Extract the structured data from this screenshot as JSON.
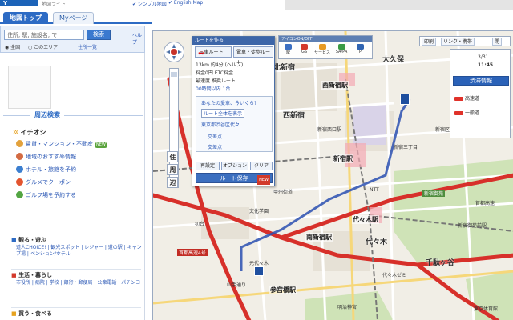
{
  "header": {
    "logo": "Y",
    "logo_sub": "地図ライト",
    "link1": "✔ シンプル地図",
    "link2": "✔ English Map"
  },
  "tabs": [
    {
      "label": "地図トップ"
    },
    {
      "label": "Myページ"
    }
  ],
  "search": {
    "placeholder": "住所, 駅, 施設名, で",
    "button": "検索",
    "help": "ヘルプ",
    "opt1": "◉ 全国",
    "opt2": "○ このエリア",
    "opt3": "住所一覧"
  },
  "sidebar": {
    "around_title": "周辺検索",
    "pickup_title": "イチオシ",
    "pickup_items": [
      {
        "label": "賃貸・マンション・不動産",
        "badge": "NEW"
      },
      {
        "label": "地域のおすすめ情報",
        "badge": ""
      },
      {
        "label": "ホテル・旅館を予約",
        "badge": ""
      },
      {
        "label": "グルメでクーポン",
        "badge": ""
      },
      {
        "label": "ゴルフ場を予約する",
        "badge": ""
      }
    ],
    "sections": [
      {
        "title": "観る・遊ぶ",
        "links": "道人CHOICE! | 観光スポット | レジャー | 道の駅 | キャンプ場 | ペンション/ホテル"
      },
      {
        "title": "生活・暮らし",
        "links": "市役所 | 病院 | 学校 | 銀行・郵便局 | 公衆電話 | パチンコ"
      },
      {
        "title": "買う・食べる",
        "links": ""
      }
    ]
  },
  "map": {
    "labels": {
      "nishishinjuku": "西新宿駅",
      "shinjuku": "新宿駅",
      "yoyogi": "代々木駅",
      "minamishinjuku": "南新宿駅",
      "sangubashi": "参宮橋駅",
      "kitashinjuku": "北新宿",
      "okubo": "大久保",
      "nishishinjuku_area": "西新宿",
      "yoyogi_area": "代々木",
      "sendagaya": "千駄ヶ谷",
      "park_label": "新宿御苑",
      "meiji": "明治神宮",
      "yoyogi_school": "代々木ゼミ",
      "bunka": "文化学園",
      "hatsudai": "初台",
      "motoyoyogi": "元代々木",
      "shinjuku_gyoen": "新宿御苑前駅",
      "ntt": "NTT",
      "kita_station": "新宿区",
      "nishiguchi": "新宿西口駅",
      "shinjukusanchome": "新宿三丁目",
      "highway": "首都高速4号",
      "koushu": "甲州街道",
      "yamate": "山手通り",
      "tokyo_tower": "東京体育館",
      "expressway_label": "首都高速"
    },
    "side_controls": {
      "s1": "住",
      "s2": "周",
      "s3": "辺"
    }
  },
  "route_panel": {
    "title": "ルートを作る",
    "mode1": "車ルート",
    "mode2": "電車・徒歩ルート",
    "l1": "13km 約4分 (ヘルプ)",
    "l2": "料金0円 ETC料金",
    "l3": "最速度 推奨ルート",
    "l4": "00時間以内 1台",
    "q": "あなたの愛車、今いくら?",
    "b1": "ルート全体を表示",
    "b2": "東京都渋谷区代々...",
    "b3": "交差点",
    "b4": "交差点",
    "f1": "再設定",
    "f2": "オプション",
    "f3": "クリア",
    "save": "ルート保存",
    "save_badge": "NEW"
  },
  "poi_toolbar": {
    "title": "アイコンON/OFF",
    "icons": [
      {
        "label": "駅",
        "color": "#3b6fc2"
      },
      {
        "label": "GS",
        "color": "#d3392b"
      },
      {
        "label": "サービス",
        "color": "#e79a23"
      },
      {
        "label": "SA/PA",
        "color": "#3a9a43"
      },
      {
        "label": "P",
        "color": "#2f64b2"
      }
    ]
  },
  "right_tools": {
    "t1": "印刷",
    "t2": "リンク・携帯",
    "t3": "閉"
  },
  "traffic": {
    "date": "3/31",
    "time": "11:45",
    "btn": "渋滞情報",
    "leg1": "高速道",
    "leg2": "一般道",
    "leg1_color": "#e0322a",
    "leg2_color": "#e0322a"
  }
}
